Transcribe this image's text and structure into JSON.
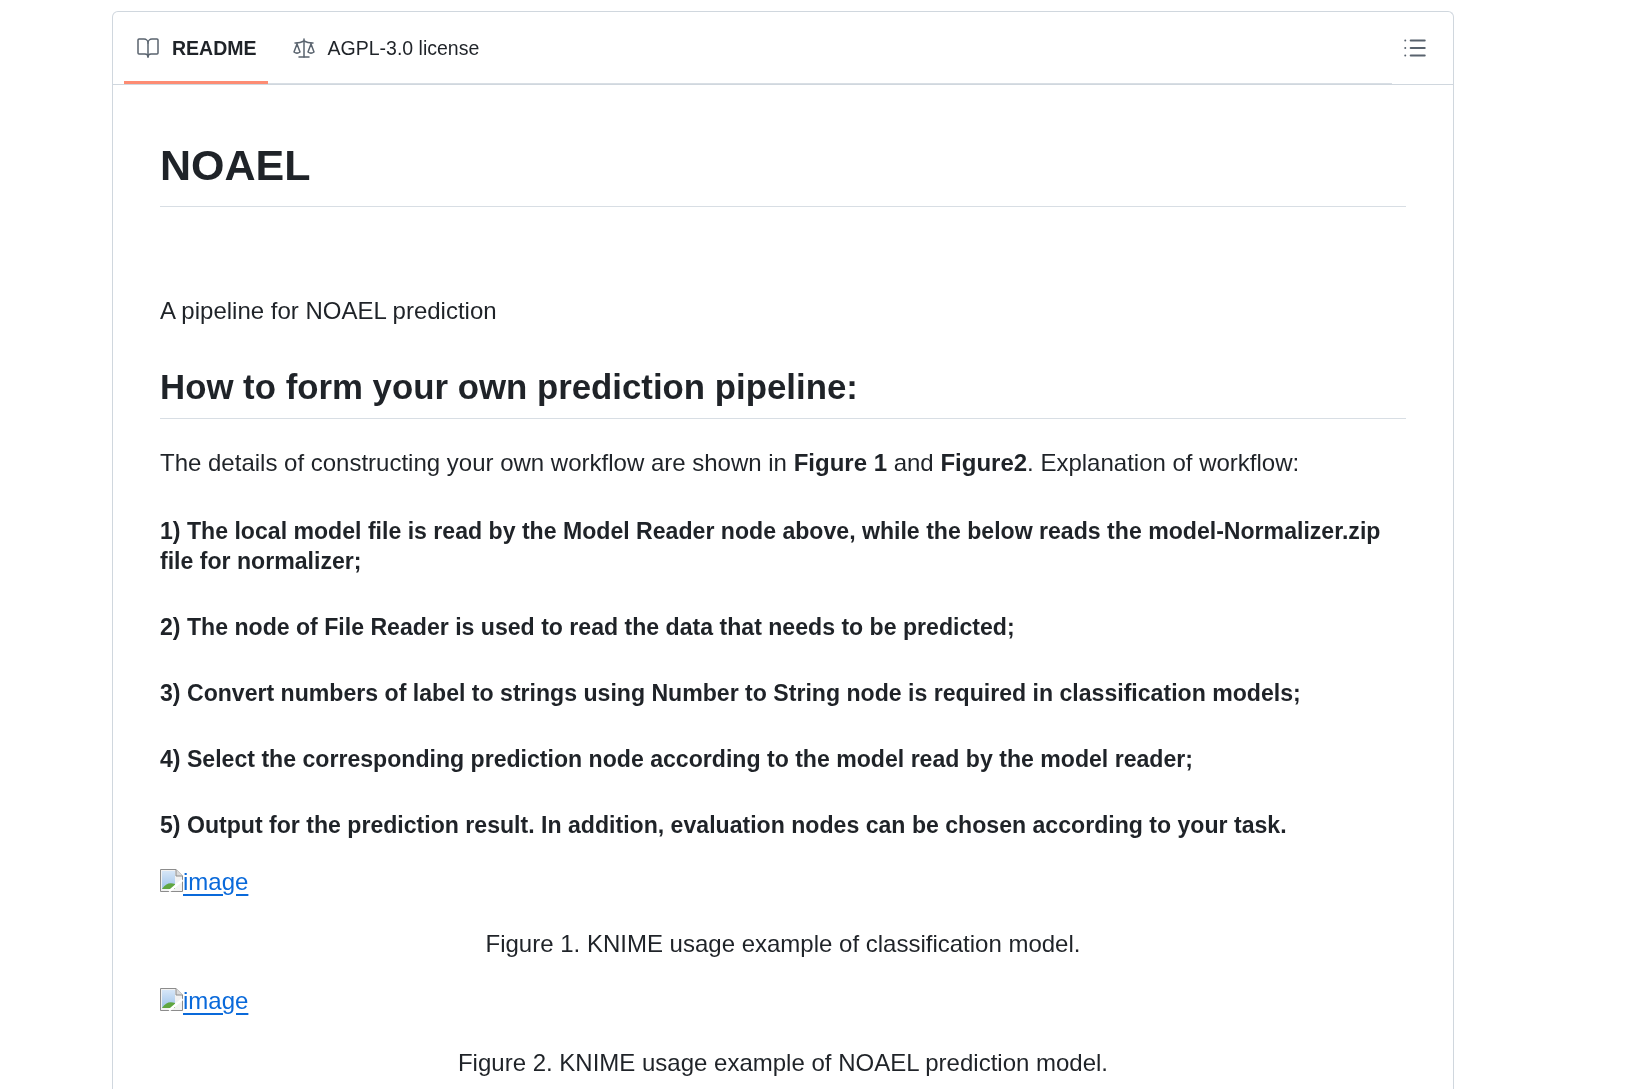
{
  "tabs": [
    {
      "kind": "readme",
      "label": "README",
      "selected": true
    },
    {
      "kind": "license",
      "label": "AGPL-3.0 license",
      "selected": false
    }
  ],
  "readme": {
    "title": "NOAEL",
    "intro": "A pipeline for NOAEL prediction",
    "section_heading": "How to form your own prediction pipeline:",
    "lead": "The details of constructing your own workflow are shown in **Figure 1** and **Figure2**. Explanation of workflow:",
    "steps": [
      "1) The local model file is read by the Model Reader node above, while the below reads the model-Normalizer.zip file for normalizer;",
      "2) The node of File Reader is used to read the data that needs to be predicted;",
      "3) Convert numbers of label to strings using Number to String node is required in classification models;",
      "4) Select the corresponding prediction node according to the model read by the model reader;",
      "5) Output for the prediction result. In addition, evaluation nodes can be chosen according to your task."
    ],
    "figures": [
      {
        "alt": "image",
        "caption": "Figure 1. KNIME usage example of classification model."
      },
      {
        "alt": "image",
        "caption": "Figure 2. KNIME usage example of NOAEL prediction model."
      }
    ]
  }
}
